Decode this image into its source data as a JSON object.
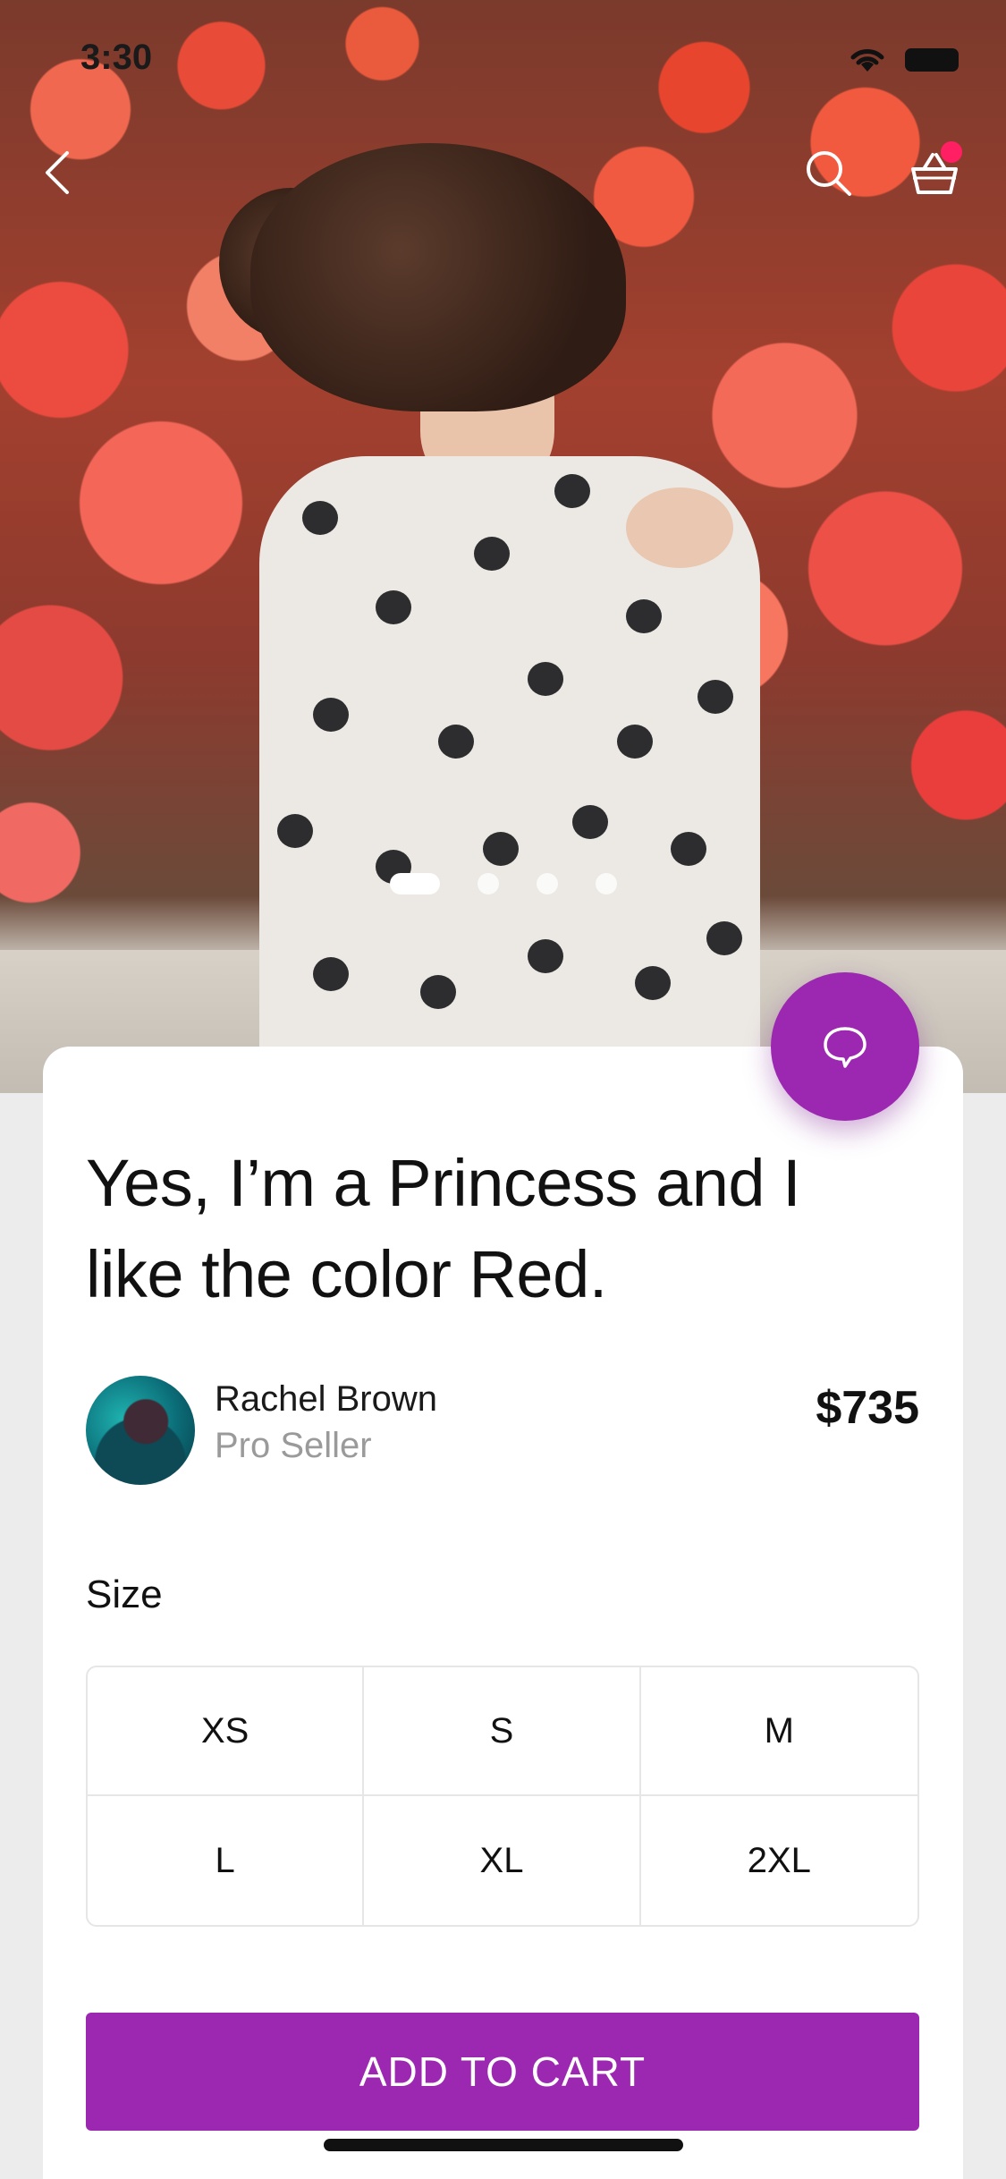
{
  "status_bar": {
    "time": "3:30"
  },
  "nav": {
    "back_icon": "chevron-left-icon",
    "search_icon": "search-icon",
    "cart_icon": "basket-icon",
    "cart_badge_color": "#ff1f62"
  },
  "gallery": {
    "total_images": 4,
    "active_index": 0
  },
  "chat": {
    "icon": "chat-bubble-icon",
    "color": "#9c27b0"
  },
  "product": {
    "title": "Yes, I’m a Princess and I like the color Red.",
    "price": "$735"
  },
  "seller": {
    "name": "Rachel Brown",
    "role": "Pro Seller"
  },
  "size": {
    "label": "Size",
    "options": [
      "XS",
      "S",
      "M",
      "L",
      "XL",
      "2XL"
    ]
  },
  "cta": {
    "label": "ADD TO CART",
    "color": "#9c27b0"
  }
}
